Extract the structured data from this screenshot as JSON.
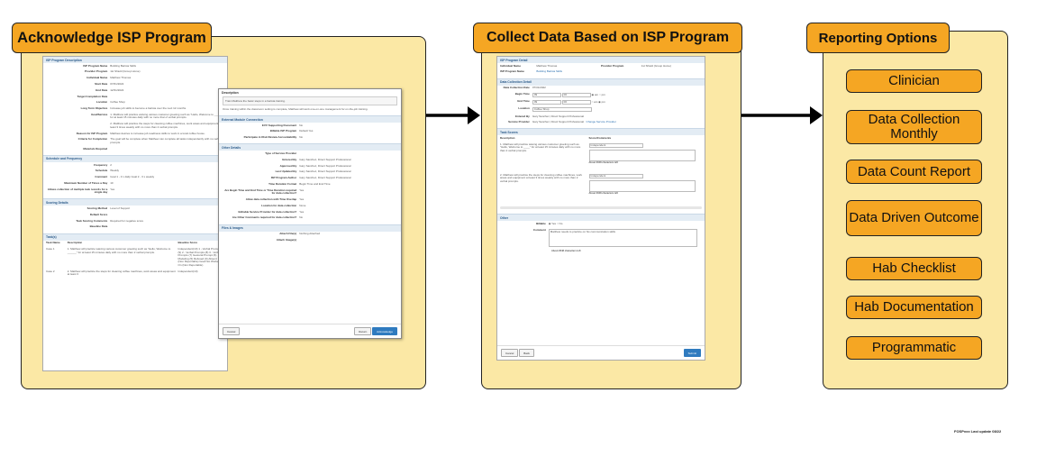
{
  "sections": {
    "acknowledge": {
      "title": "Acknowledge ISP Program"
    },
    "collect": {
      "title": "Collect Data Based on ISP Program"
    },
    "reporting": {
      "title": "Reporting Options",
      "options": [
        "Clinician",
        "Data Collection Monthly",
        "Data Count Report",
        "Data Driven Outcome",
        "Hab Checklist",
        "Hab Documentation",
        "Programmatic"
      ]
    }
  },
  "doc_isp": {
    "section_description": "ISP Program Description",
    "rows": [
      {
        "k": "ISP Program Name",
        "v": "Building Barista Skills"
      },
      {
        "k": "Provider Program",
        "v": "1st Shield (Group Home)"
      },
      {
        "k": "Individual Name",
        "v": "Matthew Thomas"
      },
      {
        "k": "Start Date",
        "v": "07/01/2022"
      },
      {
        "k": "End Date",
        "v": "12/31/2022"
      },
      {
        "k": "Target Completion Date",
        "v": ""
      },
      {
        "k": "Location",
        "v": "Coffee Shop"
      },
      {
        "k": "Long Term Objective",
        "v": "Increase job skills to become a barista over the next 12 months."
      },
      {
        "k": "Goal/Service",
        "v": "1. Matthew will practice waiving various customer greeting such as \"Hello, Welcome to ____ \" for at least 15 minutes daily with no more than 2 verbal prompts."
      },
      {
        "k": "",
        "v": "2. Matthew will practice the steps for cleaning coffee machines, work areas and equipment at least 3 times weekly with no more than 2 verbal prompts."
      },
      {
        "k": "Reason for ISP Program",
        "v": "Matthew desires to increase job readiness skills to work in a local coffee house."
      },
      {
        "k": "Criteria for Completion",
        "v": "The goal will be complete when Matthew can complete all tasks independently with no verbal prompts."
      },
      {
        "k": "Materials Required",
        "v": ""
      }
    ],
    "section_schedule": "Schedule and Frequency",
    "schedule": [
      {
        "k": "Frequency",
        "v": "2"
      },
      {
        "k": "Schedule",
        "v": "Weekly"
      },
      {
        "k": "Comment",
        "v": "Goal 1 - 3 x daily  Goal 2 - 3 x weekly"
      },
      {
        "k": "Maximum Number of Times a Day",
        "v": "10"
      },
      {
        "k": "Allows collection of multiple task records for a single day",
        "v": "Yes"
      }
    ],
    "section_scoring": "Scoring Details",
    "scoring": [
      {
        "k": "Scoring Method",
        "v": "Level of Support"
      },
      {
        "k": "Default Score",
        "v": ""
      },
      {
        "k": "Task Scoring Comments",
        "v": "Required for negative score"
      },
      {
        "k": "Baseline Data",
        "v": ""
      }
    ],
    "section_tasks": "Task(s)",
    "task_head": [
      "Task Name",
      "Description",
      "Baseline Score"
    ],
    "tasks": [
      {
        "n": "Case 1",
        "d": "1. Matthew will practice waiving various customer greeting such as \"Hello, Welcome to ______\" for at least 15 minutes daily with no more than 2 verbal prompts.",
        "s": "Independent(10) 1 - Verbal Prompt (9) 2 - Verbal Prompts (8) 3 - Verbal Prompts (7) Gestural Prompt (6) Modeling (5) Refused (0) Absent (Non Reportable) Goal Not Worked On (Non Reportable)"
      },
      {
        "n": "Case 2",
        "d": "2. Matthew will practice the steps for cleaning coffee machines, work areas and equipment at least 3",
        "s": "Independent(10)"
      }
    ]
  },
  "doc_ack": {
    "section_description": "Description",
    "desc_text": "Train Matthew the basic steps in a barista training.",
    "desc_sub": "Once training within the classroom setting is complete, Matthew will work one-on-one management for on-the-job training.",
    "section_ext": "External Module Connection",
    "ext": [
      {
        "k": "EVV Supporting Document",
        "v": "No"
      },
      {
        "k": "Billable ISP Program",
        "v": "Default Yes"
      },
      {
        "k": "Participate in Risk Review Accountability",
        "v": "No"
      }
    ],
    "section_other": "Other Details",
    "other": [
      {
        "k": "Type of Service Provider",
        "v": ""
      },
      {
        "k": "Entered By",
        "v": "Gary Sanchez, Direct Support Professional"
      },
      {
        "k": "Approved By",
        "v": "Gary Sanchez, Direct Support Professional"
      },
      {
        "k": "Last Updated By",
        "v": "Gary Sanchez, Direct Support Professional"
      },
      {
        "k": "ISP Program Author",
        "v": "Gary Sanchez, Direct Support Professional"
      },
      {
        "k": "Time Duration Format",
        "v": "Begin Time and End Time"
      },
      {
        "k": "Are Begin Time and End Time or Time Duration required for data collection?",
        "v": "Yes"
      },
      {
        "k": "Allow data collection with Time Overlap",
        "v": "Yes"
      },
      {
        "k": "Location for data collection",
        "v": "None"
      },
      {
        "k": "Editable Service Provider for data collection?",
        "v": "Yes"
      },
      {
        "k": "Are Other Comments required for data collection?",
        "v": "No"
      }
    ],
    "section_files": "Files & Images",
    "files": [
      {
        "k": "Attach File(s)",
        "v": "Nothing Attached"
      },
      {
        "k": "Attach Image(s)",
        "v": ""
      }
    ],
    "btn_cancel": "Cancel",
    "btn_return": "Return",
    "btn_acknowledge": "Acknowledge"
  },
  "doc_collect": {
    "section_detail": "ISP Program Detail",
    "individual_label": "Individual Name",
    "individual_value": "Matthew Thomas",
    "provider_label": "Provider Program",
    "provider_value": "1st Shield (Group Home)",
    "program_label": "ISP Program Name",
    "program_value": "Building Barista Skills",
    "section_collection": "Data Collection Detail",
    "date_label": "Data Collection Date",
    "date_value": "07/31/2022",
    "begin_label": "Begin Time",
    "end_label": "End Time",
    "time_h": "09",
    "time_m": "00",
    "am": "am",
    "pm": "pm",
    "location_label": "Location",
    "location_value": "Coffee Shop",
    "entered_label": "Entered By",
    "entered_value": "Gary Sanchez, Direct Support Professional",
    "service_label": "Service Provider",
    "service_value": "Gary Sanchez, Direct Support Professional",
    "change_provider": "Change Service Provider",
    "section_task": "Task Scores",
    "col_desc": "Description",
    "col_score": "Score/Comments",
    "task1": "1. Matthew will practice waving various customer greeting such as \"Hello, Welcome to ____\" for at least 15 minutes daily with no more than 2 verbal prompts.",
    "task2": "2. Matthew will practice the steps for cleaning coffee machines, work areas and equipment at least 3 times weekly with no more than 2 verbal prompts.",
    "score_value": "Independent",
    "chars_left": "About 2048 characters left",
    "section_other": "Other",
    "billable_label": "Billable",
    "yes": "Yes",
    "no": "No",
    "comment_label": "Comment",
    "comment_value": "Matthew needs to practice on his communication skills",
    "chars_left2": "About 2048 characters left",
    "btn_cancel": "Cancel",
    "btn_back": "Back",
    "btn_submit": "Submit"
  },
  "footnote": "FOSPxxx Last update 08/22",
  "colors": {
    "panel": "#fbe8a5",
    "tag": "#f5a623",
    "border": "#222222"
  }
}
